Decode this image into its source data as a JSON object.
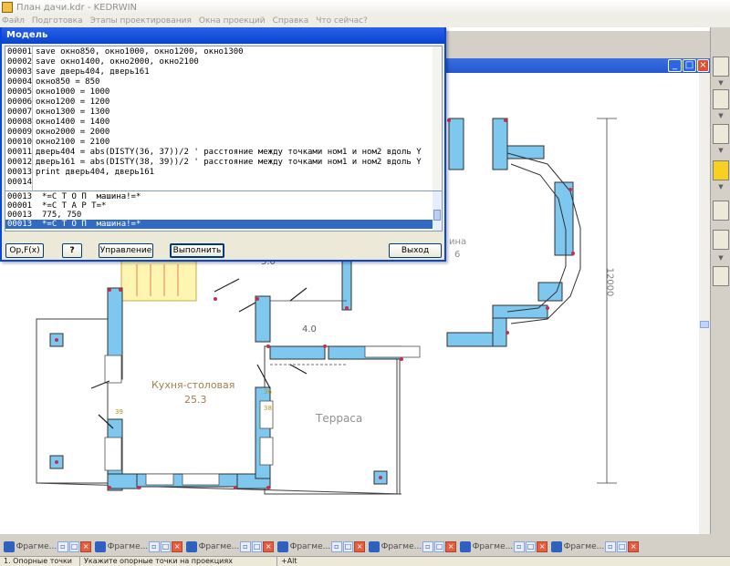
{
  "app": {
    "title": "План дачи.kdr - KEDRWIN"
  },
  "menu": [
    "Файл",
    "Подготовка",
    "Этапы проектирования",
    "Окна проекций",
    "Справка",
    "Что сейчас?"
  ],
  "dialog": {
    "title": "Модель",
    "code_lines": [
      {
        "num": "00001",
        "text": "save окно850, окно1000, окно1200, окно1300"
      },
      {
        "num": "00002",
        "text": "save окно1400, окно2000, окно2100"
      },
      {
        "num": "00003",
        "text": "save дверь404, дверь161"
      },
      {
        "num": "00004",
        "text": "окно850 = 850"
      },
      {
        "num": "00005",
        "text": "окно1000 = 1000"
      },
      {
        "num": "00006",
        "text": "окно1200 = 1200"
      },
      {
        "num": "00007",
        "text": "окно1300 = 1300"
      },
      {
        "num": "00008",
        "text": "окно1400 = 1400"
      },
      {
        "num": "00009",
        "text": "окно2000 = 2000"
      },
      {
        "num": "00010",
        "text": "окно2100 = 2100"
      },
      {
        "num": "00011",
        "text": "дверь404 = abs(DISTY(36, 37))/2 ' расстояние между точками ном1 и ном2 вдоль Y"
      },
      {
        "num": "00012",
        "text": "дверь161 = abs(DISTY(38, 39))/2 ' расстояние между точками ном1 и ном2 вдоль Y"
      },
      {
        "num": "00013",
        "text": "print дверь404, дверь161"
      },
      {
        "num": "00014",
        "text": ""
      }
    ],
    "log_lines": [
      {
        "num": "00013",
        "text": "*=С Т О П  машина!=*",
        "selected": false
      },
      {
        "num": "00001",
        "text": "*=С Т А Р Т=*",
        "selected": false
      },
      {
        "num": "00013",
        "text": "775, 750",
        "selected": false
      },
      {
        "num": "00013",
        "text": "*=С Т О П  машина!=*",
        "selected": true
      }
    ],
    "buttons": {
      "opf": "Op,F(x)",
      "help": "?",
      "control": "Управление",
      "run": "Выполнить",
      "exit": "Выход"
    }
  },
  "drawing": {
    "room_kitchen": "Кухня-столовая",
    "room_kitchen_area": "25.3",
    "room_terrace": "Терраса",
    "dim_4_0": "4.0",
    "dim_5_0": "5.0",
    "dim_12000": "12000",
    "room_partial": "ина",
    "room_partial_num": "6",
    "small_dim_1": "39",
    "small_dim_2": "38",
    "small_dim_3": "36"
  },
  "fragments": [
    {
      "label": "Фрагме..."
    },
    {
      "label": "Фрагме..."
    },
    {
      "label": "Фрагме..."
    },
    {
      "label": "Фрагме..."
    },
    {
      "label": "Фрагме..."
    },
    {
      "label": "Фрагме..."
    },
    {
      "label": "Фрагме..."
    }
  ],
  "status": {
    "left": "1. Опорные точки",
    "middle": "Укажите опорные точки на проекциях",
    "right": "+Alt"
  },
  "icons": {
    "tb1": "node-points-icon",
    "tb2": "triangle-mesh-icon",
    "tb3": "tower-icon",
    "tb4": "construction-icon",
    "tb5": "layers-icon",
    "tb6": "grid-icon",
    "tb7": "stack-icon"
  }
}
